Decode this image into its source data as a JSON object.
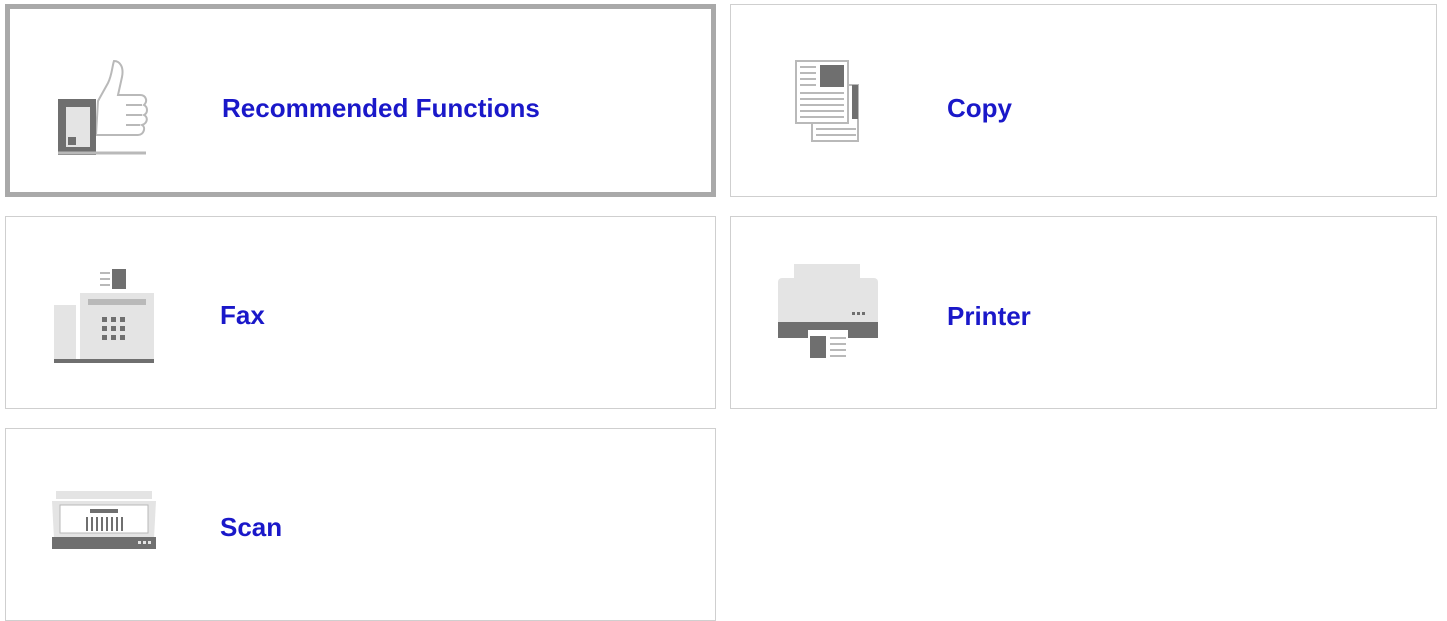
{
  "tiles": [
    {
      "id": "recommended",
      "label": "Recommended Functions",
      "icon": "thumbs-up-icon",
      "selected": true
    },
    {
      "id": "copy",
      "label": "Copy",
      "icon": "copy-document-icon",
      "selected": false
    },
    {
      "id": "fax",
      "label": "Fax",
      "icon": "fax-machine-icon",
      "selected": false
    },
    {
      "id": "printer",
      "label": "Printer",
      "icon": "printer-icon",
      "selected": false
    },
    {
      "id": "scan",
      "label": "Scan",
      "icon": "scanner-icon",
      "selected": false
    }
  ],
  "colors": {
    "label": "#1a18c9",
    "tile_border": "#cfcfcf",
    "selected_border": "#a9a9a9",
    "icon_light": "#e4e4e4",
    "icon_mid": "#b9b9b9",
    "icon_dark": "#6f6f6f"
  }
}
